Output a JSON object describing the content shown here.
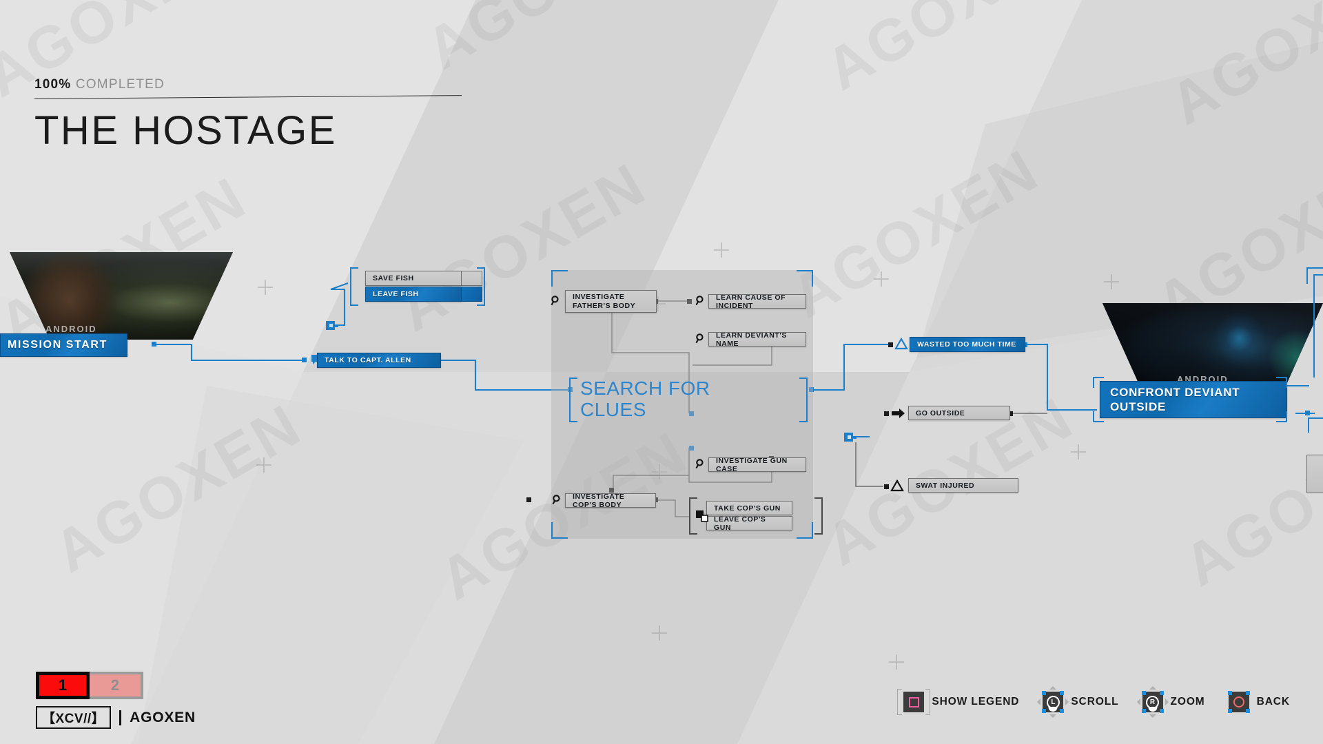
{
  "header": {
    "percent": "100%",
    "completed_label": "COMPLETED",
    "title": "THE HOSTAGE"
  },
  "flowchart": {
    "start_node": {
      "label": "MISSION  START",
      "type": "blue-objective"
    },
    "nodes": [
      {
        "id": "save-fish",
        "label": "SAVE FISH",
        "state": "inactive",
        "icon": "branch-icon"
      },
      {
        "id": "leave-fish",
        "label": "LEAVE FISH",
        "state": "selected",
        "icon": "branch-icon"
      },
      {
        "id": "talk-to-capt-allen",
        "label": "TALK TO CAPT. ALLEN",
        "state": "selected",
        "icon": "dialogue-icon"
      },
      {
        "id": "investigate-fathers-body",
        "label": "INVESTIGATE FATHER'S BODY",
        "state": "inactive",
        "icon": "magnifier-icon"
      },
      {
        "id": "learn-cause-of-incident",
        "label": "LEARN CAUSE OF INCIDENT",
        "state": "inactive",
        "icon": "magnifier-icon"
      },
      {
        "id": "learn-deviants-name",
        "label": "LEARN DEVIANT'S NAME",
        "state": "inactive",
        "icon": "magnifier-icon"
      },
      {
        "id": "investigate-gun-case",
        "label": "INVESTIGATE GUN CASE",
        "state": "inactive",
        "icon": "magnifier-icon"
      },
      {
        "id": "investigate-cops-body",
        "label": "INVESTIGATE COP'S BODY",
        "state": "inactive",
        "icon": "magnifier-icon"
      },
      {
        "id": "take-cops-gun",
        "label": "TAKE COP'S GUN",
        "state": "inactive",
        "icon": "branch-icon"
      },
      {
        "id": "leave-cops-gun",
        "label": "LEAVE COP'S GUN",
        "state": "inactive",
        "icon": "branch-icon"
      },
      {
        "id": "wasted-too-much-time",
        "label": "WASTED TOO MUCH TIME",
        "state": "selected",
        "icon": "warning-triangle-icon"
      },
      {
        "id": "go-outside",
        "label": "GO OUTSIDE",
        "state": "inactive",
        "icon": "arrow-right-icon"
      },
      {
        "id": "swat-injured",
        "label": "SWAT INJURED",
        "state": "inactive",
        "icon": "warning-triangle-icon"
      }
    ],
    "group_label": "SEARCH FOR CLUES",
    "chapter_node": {
      "label": "CONFRONT DEVIANT OUTSIDE",
      "state": "selected"
    },
    "thumbnail_tags": [
      "ANDROID",
      "ANDROID"
    ]
  },
  "hints": [
    {
      "id": "show-legend",
      "label": "SHOW LEGEND",
      "button": "square",
      "color": "#ef5fa0"
    },
    {
      "id": "scroll",
      "label": "SCROLL",
      "button": "left-stick",
      "glyph": "L"
    },
    {
      "id": "zoom",
      "label": "ZOOM",
      "button": "right-stick",
      "glyph": "R"
    },
    {
      "id": "back",
      "label": "BACK",
      "button": "circle",
      "color": "#ef6b68"
    }
  ],
  "branding": {
    "chip_one": "1",
    "chip_two": "2",
    "logo_mark": "【XCV//】",
    "logo_name": "AGOXEN",
    "watermark_text": "AGOXEN"
  }
}
